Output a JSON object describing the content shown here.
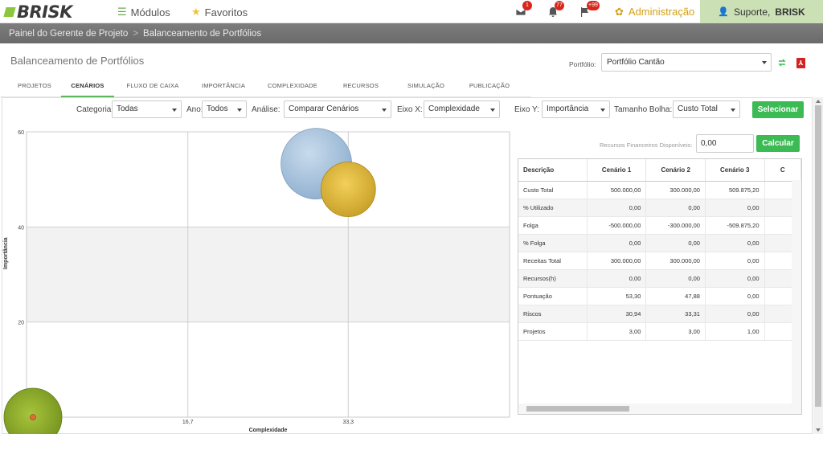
{
  "header": {
    "logo_text": "BRISK",
    "modules_label": "Módulos",
    "favorites_label": "Favoritos",
    "notifications": [
      {
        "icon": "envelope-icon",
        "count": "1"
      },
      {
        "icon": "bell-icon",
        "count": "77"
      },
      {
        "icon": "flag-icon",
        "count": "+99"
      }
    ],
    "admin_label": "Administração",
    "support_prefix": "Suporte,",
    "support_user": "BRISK"
  },
  "breadcrumb": {
    "items": [
      "Painel do Gerente de Projeto",
      "Balanceamento de Portfólios"
    ],
    "separator": ">"
  },
  "page": {
    "title": "Balanceamento de Portfólios",
    "portfolio_label": "Portfólio:",
    "portfolio_value": "Portfólio Cantão"
  },
  "tabs": [
    "PROJETOS",
    "CENÁRIOS",
    "FLUXO DE CAIXA",
    "IMPORTÂNCIA",
    "COMPLEXIDADE",
    "RECURSOS",
    "SIMULAÇÃO",
    "PUBLICAÇÃO"
  ],
  "active_tab": "CENÁRIOS",
  "filters": {
    "categoria_label": "Categoria:",
    "categoria_value": "Todas",
    "ano_label": "Ano:",
    "ano_value": "Todos",
    "analise_label": "Análise:",
    "analise_value": "Comparar Cenários",
    "eixox_label": "Eixo X:",
    "eixox_value": "Complexidade",
    "eixoy_label": "Eixo Y:",
    "eixoy_value": "Importância",
    "bolha_label": "Tamanho Bolha:",
    "bolha_value": "Custo Total",
    "select_button": "Selecionar"
  },
  "resources": {
    "label": "Recursos Financeiros Disponíveis:",
    "value": "0,00",
    "calc_button": "Calcular"
  },
  "grid": {
    "headers": [
      "Descrição",
      "Cenário 1",
      "Cenário 2",
      "Cenário 3",
      "C"
    ],
    "rows": [
      [
        "Custo Total",
        "500.000,00",
        "300.000,00",
        "509.875,20"
      ],
      [
        "% Utilizado",
        "0,00",
        "0,00",
        "0,00"
      ],
      [
        "Folga",
        "-500.000,00",
        "-300.000,00",
        "-509.875,20"
      ],
      [
        "% Folga",
        "0,00",
        "0,00",
        "0,00"
      ],
      [
        "Receitas Total",
        "300.000,00",
        "300.000,00",
        "0,00"
      ],
      [
        "Recursos(h)",
        "0,00",
        "0,00",
        "0,00"
      ],
      [
        "Pontuação",
        "53,30",
        "47,88",
        "0,00"
      ],
      [
        "Riscos",
        "30,94",
        "33,31",
        "0,00"
      ],
      [
        "Projetos",
        "3,00",
        "3,00",
        "1,00"
      ]
    ]
  },
  "chart_data": {
    "type": "bubble",
    "xlabel": "Complexidade",
    "ylabel": "Importância",
    "x_ticks": [
      "16,7",
      "33,3"
    ],
    "y_ticks": [
      "60",
      "40",
      "20"
    ],
    "xlim": [
      0,
      50
    ],
    "ylim": [
      0,
      60
    ],
    "grid": true,
    "series": [
      {
        "x": 30,
        "y": 53.3,
        "size": 500000,
        "color": "#a9c4de"
      },
      {
        "x": 33.3,
        "y": 47.9,
        "size": 300000,
        "color": "#d8b13a"
      },
      {
        "x": 0,
        "y": 0,
        "size": 509875.2,
        "color": "#8aab2c"
      }
    ]
  }
}
